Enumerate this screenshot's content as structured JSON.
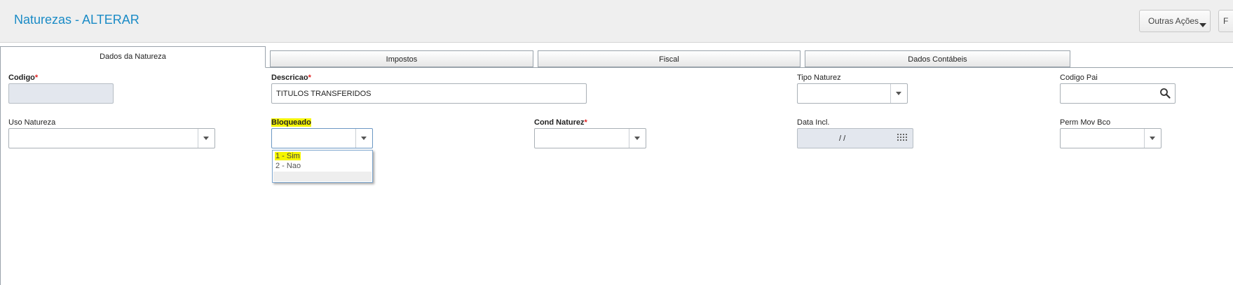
{
  "header": {
    "title": "Naturezas - ALTERAR",
    "outras_acoes_label": "Outras Ações",
    "partial_button_label": "F"
  },
  "tabs": [
    {
      "label": "Dados da Natureza",
      "active": true
    },
    {
      "label": "Impostos",
      "active": false
    },
    {
      "label": "Fiscal",
      "active": false
    },
    {
      "label": "Dados Contábeis",
      "active": false
    }
  ],
  "form": {
    "codigo": {
      "label": "Codigo",
      "required_mark": "*",
      "value": ""
    },
    "descricao": {
      "label": "Descricao",
      "required_mark": "*",
      "value": "TITULOS TRANSFERIDOS"
    },
    "tipo_naturez": {
      "label": "Tipo Naturez",
      "value": ""
    },
    "codigo_pai": {
      "label": "Codigo Pai",
      "value": ""
    },
    "uso_natureza": {
      "label": "Uso Natureza",
      "value": ""
    },
    "bloqueado": {
      "label": "Bloqueado",
      "value": "",
      "options": [
        "1 - Sim",
        "2 - Nao"
      ]
    },
    "cond_naturez": {
      "label": "Cond Naturez",
      "required_mark": "*",
      "value": ""
    },
    "data_incl": {
      "label": "Data Incl.",
      "value": " / /"
    },
    "perm_mov_bco": {
      "label": "Perm Mov Bco",
      "value": ""
    }
  },
  "colors": {
    "title": "#1a8bc6",
    "highlight": "#f5f500",
    "required": "#e02020"
  },
  "icons": [
    "chevron-down-icon",
    "search-icon",
    "calendar-icon",
    "dropdown-caret-icon"
  ]
}
